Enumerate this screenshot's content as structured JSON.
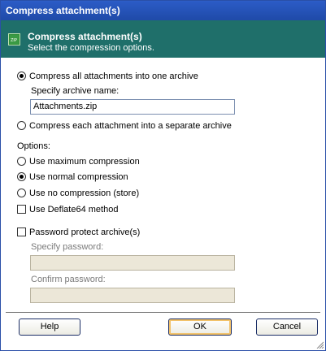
{
  "window": {
    "title": "Compress attachment(s)"
  },
  "banner": {
    "title": "Compress attachment(s)",
    "subtitle": "Select the compression options.",
    "icon": "zip-archive-icon"
  },
  "mode": {
    "compress_all_label": "Compress all attachments into one archive",
    "compress_all_selected": true,
    "archive_name_label": "Specify archive name:",
    "archive_name_value": "Attachments.zip",
    "compress_each_label": "Compress each attachment into a separate archive",
    "compress_each_selected": false
  },
  "options": {
    "heading": "Options:",
    "max_compression_label": "Use maximum compression",
    "max_compression_selected": false,
    "normal_compression_label": "Use normal compression",
    "normal_compression_selected": true,
    "no_compression_label": "Use no compression (store)",
    "no_compression_selected": false,
    "deflate64_label": "Use Deflate64 method",
    "deflate64_checked": false
  },
  "password": {
    "protect_label": "Password protect archive(s)",
    "protect_checked": false,
    "specify_label": "Specify password:",
    "specify_value": "",
    "confirm_label": "Confirm password:",
    "confirm_value": ""
  },
  "buttons": {
    "help": "Help",
    "ok": "OK",
    "cancel": "Cancel"
  },
  "colors": {
    "titlebar": "#2c5cc7",
    "banner": "#1f6f6a",
    "disabled_field": "#ece7d8"
  }
}
